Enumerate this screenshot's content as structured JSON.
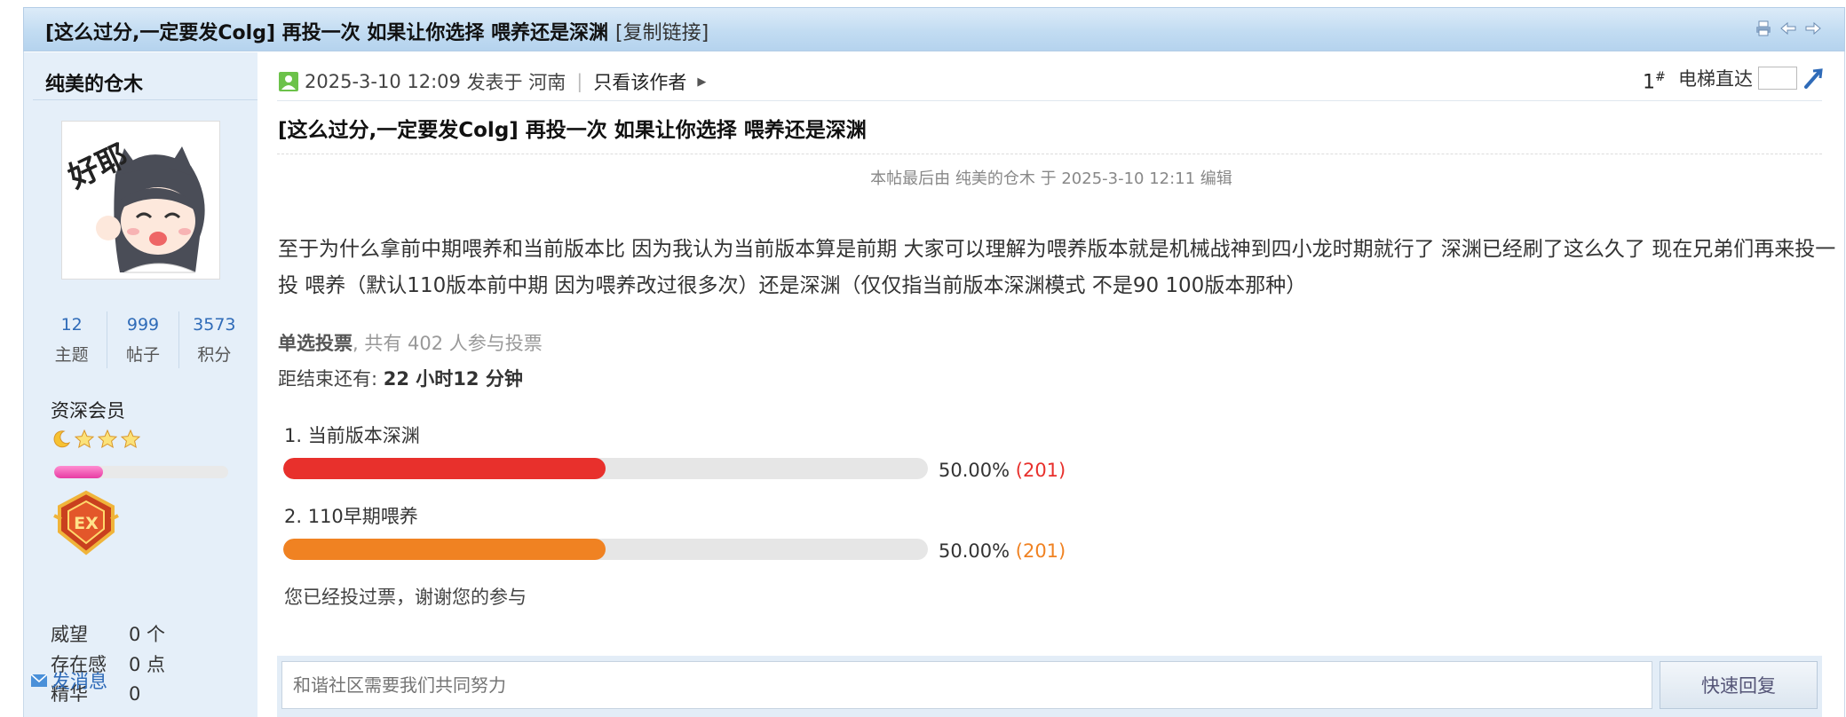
{
  "thread": {
    "title": "[这么过分,一定要发Colg] 再投一次 如果让你选择 喂养还是深渊",
    "copy_link": "[复制链接]"
  },
  "author": {
    "name": "纯美的仓木",
    "avatar_text": "好耶",
    "stats": [
      {
        "value": "12",
        "label": "主题"
      },
      {
        "value": "999",
        "label": "帖子"
      },
      {
        "value": "3573",
        "label": "积分"
      }
    ],
    "group": "资深会员",
    "level_progress": 0.28,
    "weiwang_label": "威望",
    "weiwang_value": "0 个",
    "presence_label": "存在感",
    "presence_value": "0 点",
    "jinghua_label": "精华",
    "jinghua_value": "0",
    "send_message": "发消息"
  },
  "post": {
    "datetime": "2025-3-10 12:09",
    "posted_in": "发表于",
    "location": "河南",
    "only_author": "只看该作者",
    "floor": "1",
    "floor_mark": "#",
    "elevator": "电梯直达",
    "title": "[这么过分,一定要发Colg] 再投一次 如果让你选择 喂养还是深渊",
    "edited_note": "本帖最后由 纯美的仓木 于 2025-3-10 12:11 编辑",
    "content": "至于为什么拿前中期喂养和当前版本比 因为我认为当前版本算是前期 大家可以理解为喂养版本就是机械战神到四小龙时期就行了 深渊已经刷了这么久了 现在兄弟们再来投一投 喂养（默认110版本前中期 因为喂养改过很多次）还是深渊（仅仅指当前版本深渊模式 不是90 100版本那种）"
  },
  "poll": {
    "type": "单选投票",
    "participants": ", 共有 402 人参与投票",
    "end_prefix": "距结束还有: ",
    "end_time": "22 小时12 分钟",
    "options": [
      {
        "label": "1.  当前版本深渊",
        "fraction": 0.5,
        "percent": "50.00%",
        "count": "(201)",
        "color": "#e8302c"
      },
      {
        "label": "2.  110早期喂养",
        "fraction": 0.5,
        "percent": "50.00%",
        "count": "(201)",
        "color": "#f08222"
      }
    ],
    "voted_note": "您已经投过票，谢谢您的参与"
  },
  "reply": {
    "placeholder": "和谐社区需要我们共同努力",
    "button": "快速回复"
  }
}
